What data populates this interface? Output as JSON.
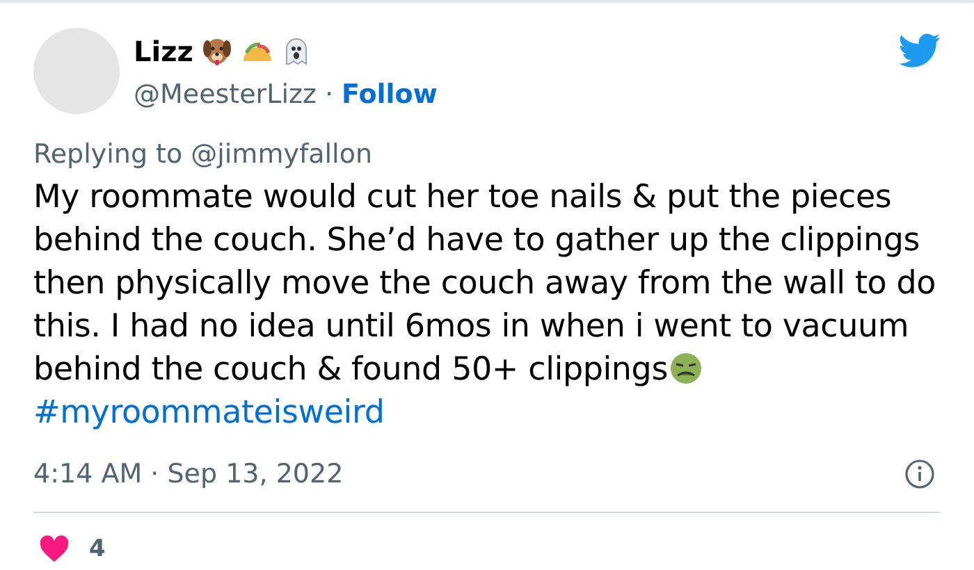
{
  "author": {
    "name": "Lizz",
    "handle": "@MeesterLizz",
    "separator": "·",
    "follow": "Follow"
  },
  "replying": {
    "prefix": "Replying to",
    "mention": "@jimmyfallon"
  },
  "body": {
    "text": "My roommate would cut her toe nails & put the pieces behind the couch. She’d have to gather up the clippings then physically move the couch away from the wall to do this. I had no idea until 6mos in when i went to vacuum behind the couch & found 50+ clippings",
    "hashtag": "#myroommateisweird"
  },
  "timestamp": "4:14 AM · Sep 13, 2022",
  "likes": {
    "count": "4"
  }
}
